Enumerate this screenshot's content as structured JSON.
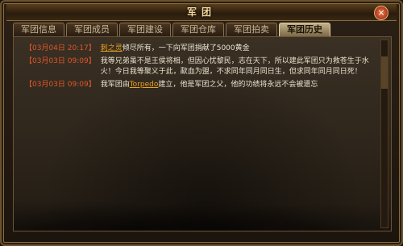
{
  "window": {
    "title": "军团",
    "close_icon": "close-icon"
  },
  "tabs": [
    {
      "label": "军团信息"
    },
    {
      "label": "军团成员"
    },
    {
      "label": "军团建设"
    },
    {
      "label": "军团仓库"
    },
    {
      "label": "军团拍卖"
    },
    {
      "label": "军团历史",
      "active": true
    }
  ],
  "history": [
    {
      "time": "【03月04日 20:17】",
      "name": "刺之灵",
      "text": "倾尽所有，一下向军团捐献了5000黄金"
    },
    {
      "time": "【03月03日 09:09】",
      "name": "",
      "text": "我等兄弟虽不是王侯将相，但因心忧黎民，志在天下，所以建此军团只为救苍生于水火！今日我等聚义于此，歃血为盟，不求同年同月同日生，但求同年同月同日死！"
    },
    {
      "time": "【03月03日 09:09】",
      "name": "Torpedo",
      "text_before": "我军团由",
      "text": "建立，他是军团之父，他的功绩将永远不会被遗忘"
    }
  ],
  "colors": {
    "timestamp": "#e0562a",
    "name": "#e8a020",
    "text": "#e9e2cf"
  }
}
